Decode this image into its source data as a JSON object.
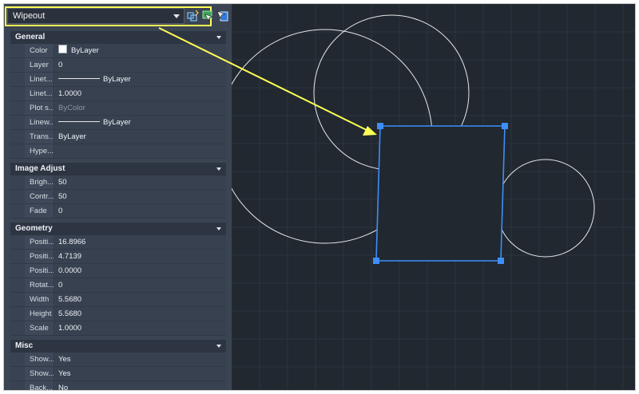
{
  "palette": {
    "selector": {
      "value": "Wipeout"
    },
    "toolbar": {
      "icons": [
        "quick-select-icon",
        "select-objects-icon",
        "toggle-pickadd-icon"
      ]
    },
    "sections": [
      {
        "title": "General",
        "rows": [
          {
            "name": "Color",
            "value": "ByLayer",
            "swatch": "#ffffff"
          },
          {
            "name": "Layer",
            "value": "0"
          },
          {
            "name": "Linet...",
            "value": "ByLayer",
            "line": true
          },
          {
            "name": "Linet...",
            "value": "1.0000"
          },
          {
            "name": "Plot s...",
            "value": "ByColor",
            "dim": true
          },
          {
            "name": "Linew...",
            "value": "ByLayer",
            "line": true
          },
          {
            "name": "Trans...",
            "value": "ByLayer"
          },
          {
            "name": "Hype...",
            "value": ""
          }
        ]
      },
      {
        "title": "Image Adjust",
        "rows": [
          {
            "name": "Brigh...",
            "value": "50"
          },
          {
            "name": "Contr...",
            "value": "50"
          },
          {
            "name": "Fade",
            "value": "0"
          }
        ]
      },
      {
        "title": "Geometry",
        "rows": [
          {
            "name": "Positi...",
            "value": "16.8966"
          },
          {
            "name": "Positi...",
            "value": "4.7139"
          },
          {
            "name": "Positi...",
            "value": "0.0000"
          },
          {
            "name": "Rotat...",
            "value": "0"
          },
          {
            "name": "Width",
            "value": "5.5680"
          },
          {
            "name": "Height",
            "value": "5.5680"
          },
          {
            "name": "Scale",
            "value": "1.0000"
          }
        ]
      },
      {
        "title": "Misc",
        "rows": [
          {
            "name": "Show...",
            "value": "Yes"
          },
          {
            "name": "Show...",
            "value": "Yes"
          },
          {
            "name": "Back...",
            "value": "No"
          }
        ]
      }
    ]
  },
  "colors": {
    "canvas_background": "#212830",
    "grid": "#2c3541",
    "selection": "#3e8ef7",
    "annotation": "#ffff55",
    "geometry": "#e8e8e8"
  }
}
